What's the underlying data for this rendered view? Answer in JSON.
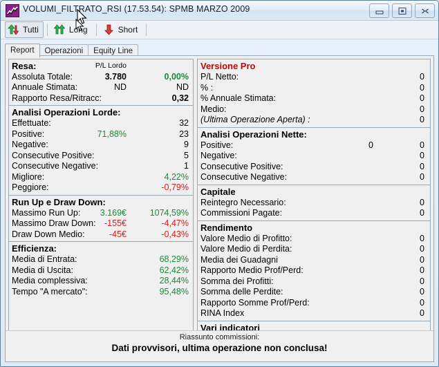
{
  "window": {
    "title": "VOLUMI_FILTRATO_RSI (17.53.54): SPMB MARZO 2009",
    "app_icon": "chart-line-icon",
    "minimize_label": "minimize-icon",
    "maximize_label": "restore-icon",
    "close_label": "close-icon"
  },
  "toolbar": {
    "buttons": [
      {
        "label": "Tutti",
        "icon": "up-down-arrows-icon",
        "pressed": true
      },
      {
        "label": "Long",
        "icon": "double-up-arrow-icon",
        "pressed": false
      },
      {
        "label": "Short",
        "icon": "down-arrow-icon",
        "pressed": false
      }
    ]
  },
  "tabs": [
    {
      "label": "Report",
      "active": true
    },
    {
      "label": "Operazioni",
      "active": false
    },
    {
      "label": "Equity Line",
      "active": false
    }
  ],
  "left_pane": {
    "groups": [
      {
        "title": "Resa:",
        "column_note": "P/L Lordo",
        "rows": [
          {
            "label": "Assoluta Totale:",
            "value_a": "3.780",
            "value_a_style": "bold",
            "value_b": "0,00%",
            "value_b_style": "pos bold"
          },
          {
            "label": "Annuale Stimata:",
            "value_a": "ND",
            "value_a_style": "",
            "value_b": "ND",
            "value_b_style": ""
          },
          {
            "label": "Rapporto Resa/Ritracc:",
            "value_a": "",
            "value_a_style": "",
            "value_b": "0,32",
            "value_b_style": "bold"
          }
        ]
      },
      {
        "title": "Analisi Operazioni Lorde:",
        "rows": [
          {
            "label": "Effettuate:",
            "value_a": "",
            "value_a_style": "",
            "value_b": "32",
            "value_b_style": ""
          },
          {
            "label": "Positive:",
            "value_a": "71,88%",
            "value_a_style": "pos",
            "value_b": "23",
            "value_b_style": ""
          },
          {
            "label": "Negative:",
            "value_a": "",
            "value_a_style": "",
            "value_b": "9",
            "value_b_style": ""
          },
          {
            "label": "Consecutive Positive:",
            "value_a": "",
            "value_a_style": "",
            "value_b": "5",
            "value_b_style": ""
          },
          {
            "label": "Consecutive Negative:",
            "value_a": "",
            "value_a_style": "",
            "value_b": "1",
            "value_b_style": ""
          },
          {
            "label": "Migliore:",
            "value_a": "",
            "value_a_style": "",
            "value_b": "4,22%",
            "value_b_style": "pos"
          },
          {
            "label": "Peggiore:",
            "value_a": "",
            "value_a_style": "",
            "value_b": "-0,79%",
            "value_b_style": "neg"
          }
        ]
      },
      {
        "title": "Run Up e Draw Down:",
        "rows": [
          {
            "label": "Massimo Run Up:",
            "value_a": "3.169€",
            "value_a_style": "pos",
            "value_b": "1074,59%",
            "value_b_style": "pos"
          },
          {
            "label": "Massimo Draw Down:",
            "value_a": "-155€",
            "value_a_style": "neg",
            "value_b": "-4,47%",
            "value_b_style": "neg"
          },
          {
            "label": "Draw Down Medio:",
            "value_a": "-45€",
            "value_a_style": "neg",
            "value_b": "-0,43%",
            "value_b_style": "neg"
          }
        ]
      },
      {
        "title": "Efficienza:",
        "rows": [
          {
            "label": "Media di Entrata:",
            "value_a": "",
            "value_a_style": "",
            "value_b": "68,29%",
            "value_b_style": "pos"
          },
          {
            "label": "Media di Uscita:",
            "value_a": "",
            "value_a_style": "",
            "value_b": "62,42%",
            "value_b_style": "pos"
          },
          {
            "label": "Media complessiva:",
            "value_a": "",
            "value_a_style": "",
            "value_b": "28,44%",
            "value_b_style": "pos"
          },
          {
            "label": "Tempo \"A mercato\":",
            "value_a": "",
            "value_a_style": "",
            "value_b": "95,48%",
            "value_b_style": "pos"
          }
        ]
      }
    ]
  },
  "right_pane": {
    "groups": [
      {
        "title": "Versione Pro",
        "title_style": "pro",
        "rows": [
          {
            "label": "P/L Netto:",
            "value_mid": "",
            "value_end": "0"
          },
          {
            "label": "% :",
            "value_mid": "",
            "value_end": "0"
          },
          {
            "label": "% Annuale Stimata:",
            "value_mid": "",
            "value_end": "0"
          },
          {
            "label": "Medio:",
            "value_mid": "",
            "value_end": "0"
          },
          {
            "label": "(Ultima Operazione Aperta) :",
            "value_mid": "",
            "value_end": "0",
            "italic": true
          }
        ]
      },
      {
        "title": "Analisi Operazioni Nette:",
        "rows": [
          {
            "label": "Positive:",
            "value_mid": "0",
            "value_end": "0"
          },
          {
            "label": "Negative:",
            "value_mid": "",
            "value_end": "0"
          },
          {
            "label": "Consecutive Positive:",
            "value_mid": "",
            "value_end": "0"
          },
          {
            "label": "Consecutive Negative:",
            "value_mid": "",
            "value_end": "0"
          }
        ]
      },
      {
        "title": "Capitale",
        "rows": [
          {
            "label": "Reintegro Necessario:",
            "value_mid": "",
            "value_end": "0"
          },
          {
            "label": "Commissioni Pagate:",
            "value_mid": "",
            "value_end": "0"
          }
        ]
      },
      {
        "title": "Rendimento",
        "rows": [
          {
            "label": "Valore Medio di Profitto:",
            "value_mid": "",
            "value_end": "0"
          },
          {
            "label": "Valore Medio di Perdita:",
            "value_mid": "",
            "value_end": "0"
          },
          {
            "label": "Media dei Guadagni",
            "value_mid": "",
            "value_end": "0"
          },
          {
            "label": "Rapporto Medio Prof/Perd:",
            "value_mid": "",
            "value_end": "0"
          },
          {
            "label": "Somma dei Profitti:",
            "value_mid": "",
            "value_end": "0"
          },
          {
            "label": "Somma delle Perdite:",
            "value_mid": "",
            "value_end": "0"
          },
          {
            "label": "Rapporto Somme Prof/Perd:",
            "value_mid": "",
            "value_end": "0"
          },
          {
            "label": "RINA Index",
            "value_mid": "",
            "value_end": "0"
          }
        ]
      },
      {
        "title": "Vari indicatori",
        "rows": []
      }
    ]
  },
  "footer": {
    "line1": "Riassunto commissioni:",
    "line2": "Dati provvisori, ultima operazione non conclusa!"
  },
  "colors": {
    "positive": "#1a8a3a",
    "negative": "#d81c1c",
    "pro_header": "#d00000",
    "titlebar_top": "#f2f7fb",
    "titlebar_bottom": "#dbe9f5",
    "panel_bg": "#f0f0f0"
  }
}
